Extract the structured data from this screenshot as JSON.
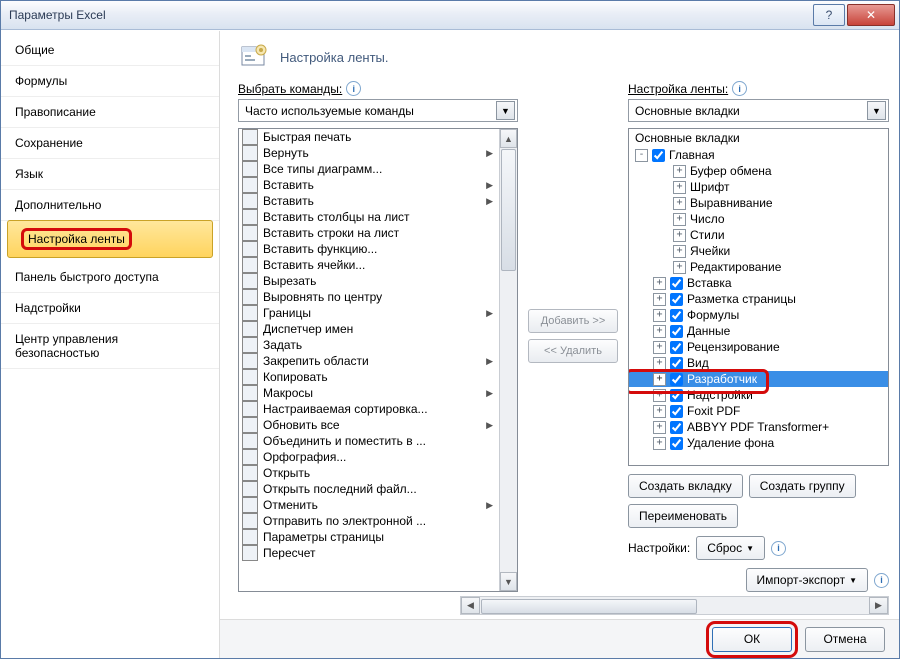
{
  "window": {
    "title": "Параметры Excel"
  },
  "sidebar": {
    "items": [
      {
        "label": "Общие"
      },
      {
        "label": "Формулы"
      },
      {
        "label": "Правописание"
      },
      {
        "label": "Сохранение"
      },
      {
        "label": "Язык"
      },
      {
        "label": "Дополнительно"
      },
      {
        "label": "Настройка ленты",
        "active": true,
        "highlight": true
      },
      {
        "label": "Панель быстрого доступа"
      },
      {
        "label": "Надстройки"
      },
      {
        "label": "Центр управления безопасностью"
      }
    ]
  },
  "header": {
    "title": "Настройка ленты."
  },
  "left": {
    "label": "Выбрать команды:",
    "combo": "Часто используемые команды",
    "commands": [
      {
        "label": "Быстрая печать"
      },
      {
        "label": "Вернуть",
        "sub": true
      },
      {
        "label": "Все типы диаграмм..."
      },
      {
        "label": "Вставить",
        "sub": true
      },
      {
        "label": "Вставить",
        "sub": true
      },
      {
        "label": "Вставить столбцы на лист"
      },
      {
        "label": "Вставить строки на лист"
      },
      {
        "label": "Вставить функцию..."
      },
      {
        "label": "Вставить ячейки..."
      },
      {
        "label": "Вырезать"
      },
      {
        "label": "Выровнять по центру"
      },
      {
        "label": "Границы",
        "sub": true
      },
      {
        "label": "Диспетчер имен"
      },
      {
        "label": "Задать"
      },
      {
        "label": "Закрепить области",
        "sub": true
      },
      {
        "label": "Копировать"
      },
      {
        "label": "Макросы",
        "sub": true
      },
      {
        "label": "Настраиваемая сортировка..."
      },
      {
        "label": "Обновить все",
        "sub": true
      },
      {
        "label": "Объединить и поместить в ..."
      },
      {
        "label": "Орфография..."
      },
      {
        "label": "Открыть"
      },
      {
        "label": "Открыть последний файл..."
      },
      {
        "label": "Отменить",
        "sub": true
      },
      {
        "label": "Отправить по электронной ..."
      },
      {
        "label": "Параметры страницы"
      },
      {
        "label": "Пересчет"
      }
    ]
  },
  "mid": {
    "add": "Добавить >>",
    "remove": "<< Удалить"
  },
  "right": {
    "label": "Настройка ленты:",
    "combo": "Основные вкладки",
    "tree_title": "Основные вкладки",
    "root": {
      "label": "Главная",
      "checked": true,
      "exp": "-"
    },
    "groups": [
      {
        "label": "Буфер обмена"
      },
      {
        "label": "Шрифт"
      },
      {
        "label": "Выравнивание"
      },
      {
        "label": "Число"
      },
      {
        "label": "Стили"
      },
      {
        "label": "Ячейки"
      },
      {
        "label": "Редактирование"
      }
    ],
    "tabs": [
      {
        "label": "Вставка",
        "checked": true
      },
      {
        "label": "Разметка страницы",
        "checked": true
      },
      {
        "label": "Формулы",
        "checked": true
      },
      {
        "label": "Данные",
        "checked": true
      },
      {
        "label": "Рецензирование",
        "checked": true
      },
      {
        "label": "Вид",
        "checked": true
      },
      {
        "label": "Разработчик",
        "checked": true,
        "selected": true,
        "highlight": true
      },
      {
        "label": "Надстройки",
        "checked": true
      },
      {
        "label": "Foxit PDF",
        "checked": true
      },
      {
        "label": "ABBYY PDF Transformer+",
        "checked": true
      },
      {
        "label": "Удаление фона",
        "checked": true
      }
    ],
    "buttons": {
      "new_tab": "Создать вкладку",
      "new_group": "Создать группу",
      "rename": "Переименовать"
    },
    "settings_label": "Настройки:",
    "reset": "Сброс",
    "import_export": "Импорт-экспорт"
  },
  "footer": {
    "ok": "ОК",
    "cancel": "Отмена"
  }
}
